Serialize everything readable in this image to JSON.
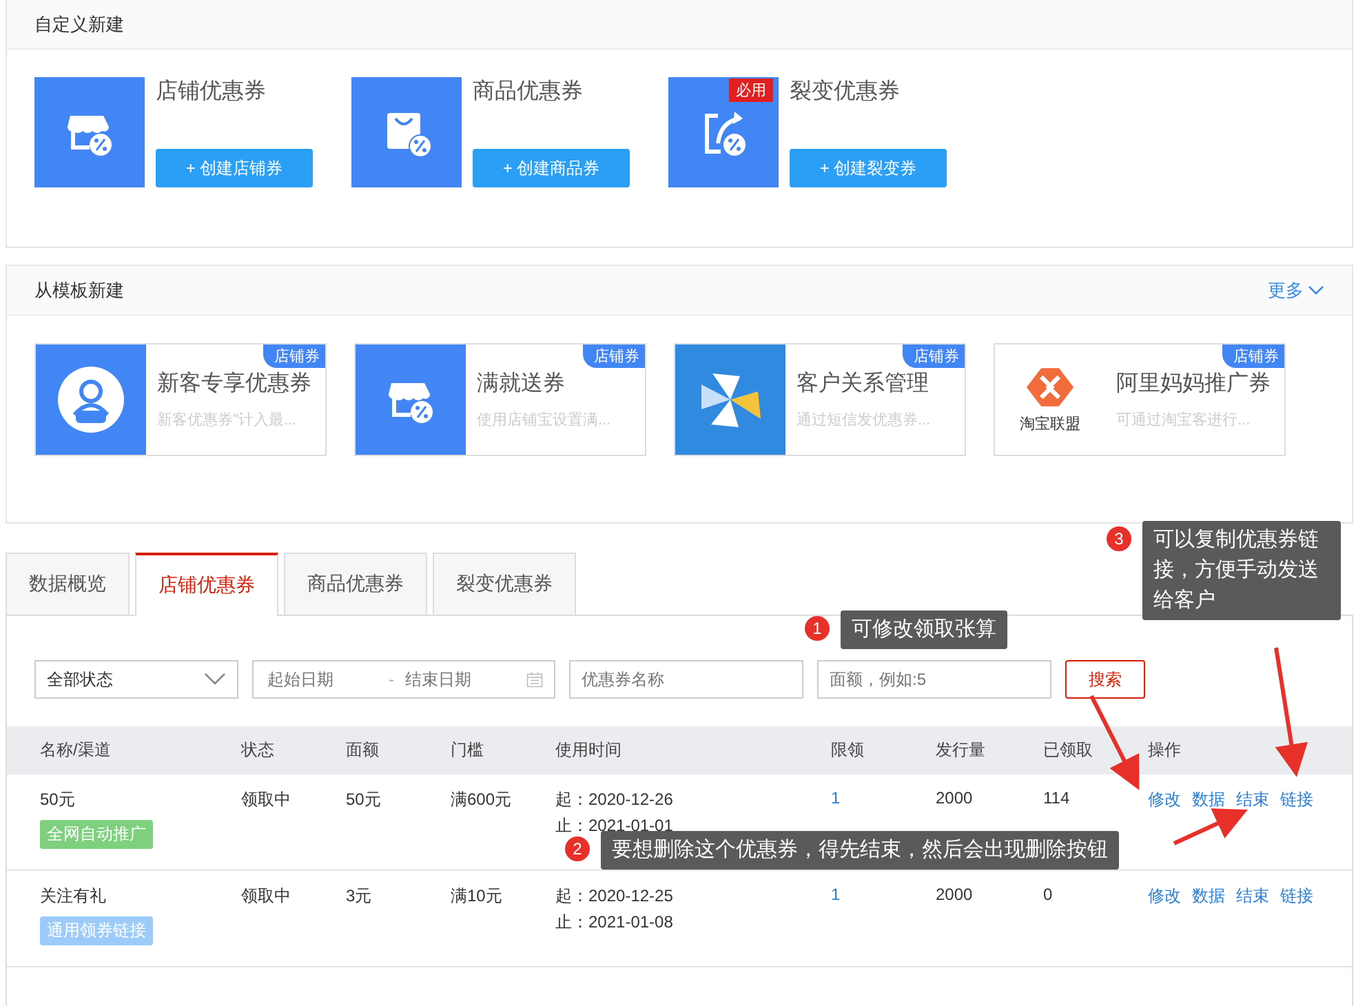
{
  "custom_create": {
    "title": "自定义新建",
    "items": [
      {
        "kind": "store",
        "title": "店铺优惠券",
        "button": "+ 创建店铺券"
      },
      {
        "kind": "bag",
        "title": "商品优惠券",
        "button": "+ 创建商品券"
      },
      {
        "kind": "share",
        "title": "裂变优惠券",
        "button": "+ 创建裂变券",
        "badge": "必用"
      }
    ]
  },
  "template_create": {
    "title": "从模板新建",
    "more": "更多",
    "items": [
      {
        "kind": "new-user",
        "title": "新客专享优惠券",
        "desc": "新客优惠券\"计入最...",
        "tag": "店铺券"
      },
      {
        "kind": "store",
        "title": "满就送券",
        "desc": "使用店铺宝设置满...",
        "tag": "店铺券"
      },
      {
        "kind": "pinwheel",
        "title": "客户关系管理",
        "desc": "通过短信发优惠券...",
        "tag": "店铺券"
      },
      {
        "kind": "union",
        "logo_text": "淘宝联盟",
        "title": "阿里妈妈推广券",
        "desc": "可通过淘宝客进行...",
        "tag": "店铺券"
      }
    ]
  },
  "tabs": [
    {
      "label": "数据概览",
      "selected": false
    },
    {
      "label": "店铺优惠券",
      "selected": true
    },
    {
      "label": "商品优惠券",
      "selected": false
    },
    {
      "label": "裂变优惠券",
      "selected": false
    }
  ],
  "filters": {
    "status": "全部状态",
    "start_date": {
      "placeholder": "起始日期"
    },
    "separator": "-",
    "end_date": {
      "placeholder": "结束日期"
    },
    "name": {
      "placeholder": "优惠券名称"
    },
    "amount": {
      "placeholder": "面额，例如:5"
    },
    "search": "搜索"
  },
  "table": {
    "columns": [
      "名称/渠道",
      "状态",
      "面额",
      "门槛",
      "使用时间",
      "限领",
      "发行量",
      "已领取",
      "操作"
    ],
    "rows": [
      {
        "name": "50元",
        "tag": "全网自动推广",
        "color": "#7ed07e",
        "status": "领取中",
        "value": "50元",
        "threshold": "满600元",
        "start": "起：2020-12-26",
        "end": "止：2021-01-01",
        "limit": "1",
        "issued": "2000",
        "claimed": "114",
        "actions": [
          "修改",
          "数据",
          "结束",
          "链接"
        ]
      },
      {
        "name": "关注有礼",
        "tag": "通用领券链接",
        "color": "#9ccbf9",
        "status": "领取中",
        "value": "3元",
        "threshold": "满10元",
        "start": "起：2020-12-25",
        "end": "止：2021-01-08",
        "limit": "1",
        "issued": "2000",
        "claimed": "0",
        "actions": [
          "修改",
          "数据",
          "结束",
          "链接"
        ]
      }
    ]
  },
  "annotations": [
    {
      "number": "1",
      "text": "可修改领取张算"
    },
    {
      "number": "3",
      "text": "可以复制优惠券链接，方便手动发送给客户"
    },
    {
      "number": "2",
      "text": "要想删除这个优惠券，得先结束，然后会出现删除按钮"
    }
  ]
}
